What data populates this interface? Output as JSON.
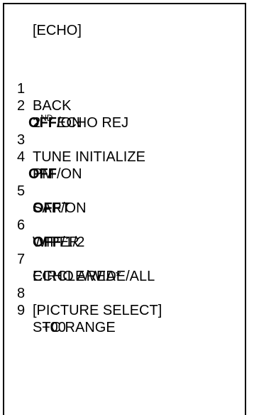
{
  "menu": {
    "title": "[ECHO]",
    "items": [
      {
        "number": "1",
        "label": "BACK"
      },
      {
        "number": "2",
        "label_pre": "2",
        "label_sup": "ND",
        "label_post": " ECHO REJ",
        "option_selected": "OFF",
        "option_rest": "/ON"
      },
      {
        "number": "3",
        "label": "TUNE INITIALIZE"
      },
      {
        "number": "4",
        "label": "PM",
        "option_selected": "OFF",
        "option_rest": "/ON"
      },
      {
        "number": "5",
        "label": "SART",
        "option_selected": "OFF",
        "option_rest": "/ON"
      },
      {
        "number": "6",
        "label": "WIPER",
        "option_selected": "OFF",
        "option_rest": "/1/2"
      },
      {
        "number": "7",
        "label": "ECHO AREA*",
        "options": "CIRCLE/WIDE/ALL"
      },
      {
        "number": "8",
        "label": "[PICTURE SELECT]"
      },
      {
        "number": "9",
        "label": "STC RANGE",
        "value": "+00"
      }
    ]
  }
}
